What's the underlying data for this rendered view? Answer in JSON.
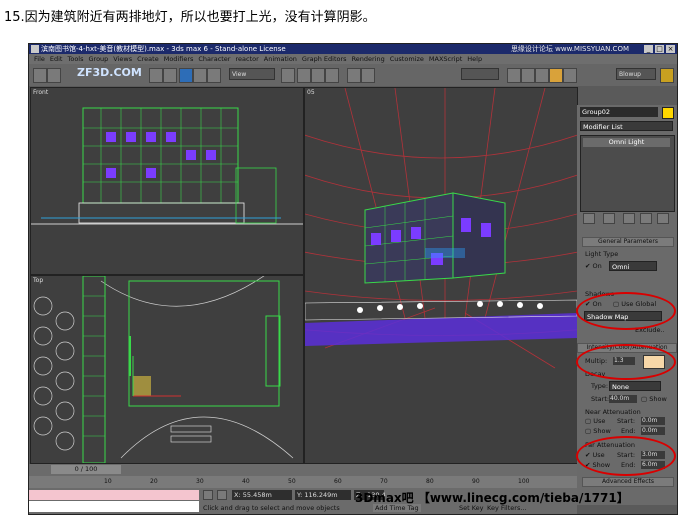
{
  "caption": "15.因为建筑附近有两排地灯，所以也要打上光，没有计算阴影。",
  "window": {
    "title": "滨南图书馆-4-hxt-美音(教材模型).max - 3ds max 6 - Stand-alone License",
    "watermark_site": "思缘设计论坛 www.MISSYUAN.COM",
    "buttons": [
      "_",
      "□",
      "×"
    ]
  },
  "menu": [
    "File",
    "Edit",
    "Tools",
    "Group",
    "Views",
    "Create",
    "Modifiers",
    "Character",
    "reactor",
    "Animation",
    "Graph Editors",
    "Rendering",
    "Customize",
    "MAXScript",
    "Help"
  ],
  "toolbar": {
    "view_dropdown": "View",
    "blowup_dropdown": "Blowup",
    "logo": "ZF3D.COM"
  },
  "viewports": {
    "front": "Front",
    "persp": "05",
    "top": "Top"
  },
  "command_panel": {
    "object_name": "Group02",
    "modifier_list": "Modifier List",
    "stack_item": "Omni Light",
    "general_parameters": "General Parameters",
    "light_type_label": "Light Type",
    "light_on_label": "On",
    "light_type_value": "Omni",
    "shadows_label": "Shadows",
    "shadows_on_label": "On",
    "use_global_label": "Use Global",
    "shadow_type_value": "Shadow Map",
    "exclude_label": "Exclude..",
    "intensity_section": "Intensity/Color/Attenuation",
    "multiplier_label": "Multip:",
    "multiplier_value": "1.3",
    "light_color": "#f7d7a8",
    "decay_label": "Decay",
    "decay_type_label": "Type:",
    "decay_type_value": "None",
    "decay_start_label": "Start:",
    "decay_start_value": "40.0m",
    "decay_show_label": "Show",
    "near_atten_label": "Near Attenuation",
    "near_use_label": "Use",
    "near_start_label": "Start:",
    "near_start_value": "0.0m",
    "near_show_label": "Show",
    "near_end_label": "End:",
    "near_end_value": "0.0m",
    "far_atten_label": "Far Attenuation",
    "far_use_label": "Use",
    "far_start_label": "Start:",
    "far_start_value": "3.0m",
    "far_show_label": "Show",
    "far_end_label": "End:",
    "far_end_value": "6.0m",
    "advanced_effects": "Advanced Effects"
  },
  "status": {
    "timeline": "0 / 100",
    "ticks": [
      "10",
      "20",
      "30",
      "40",
      "50",
      "60",
      "70",
      "80",
      "90",
      "100"
    ],
    "x_label": "X:",
    "x_value": "55.458m",
    "y_label": "Y:",
    "y_value": "116.249m",
    "z_label": "Z:",
    "z_value": "-130.4",
    "prompt": "Click and drag to select and move objects",
    "add_time_tag": "Add Time Tag",
    "set_key": "Set Key",
    "key_filters": "Key Filters...",
    "watermark": "3Dmax吧 【www.linecg.com/tieba/1771】"
  },
  "colors": {
    "highlight_ring": "#d90000",
    "title_bar": "#1c2a6b",
    "wire_green": "#39d94a",
    "wire_purple": "#7b3cff",
    "grid_red": "#b2323a"
  }
}
